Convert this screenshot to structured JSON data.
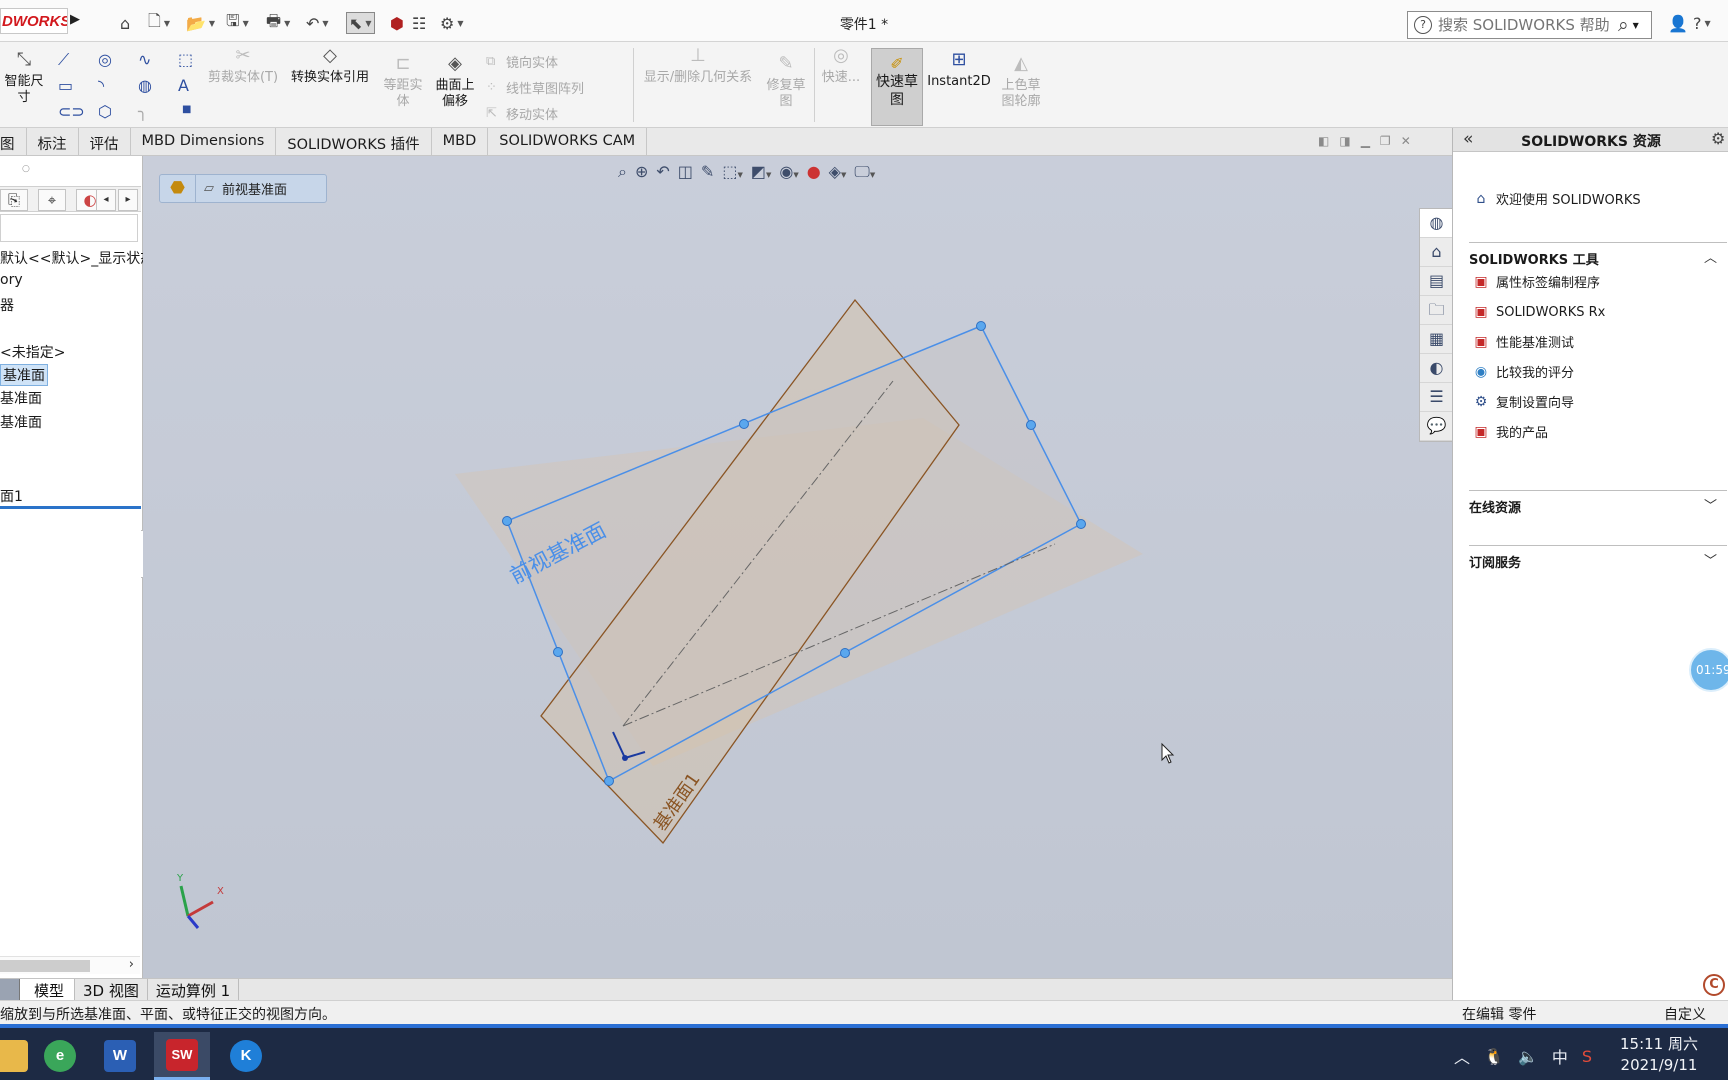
{
  "titlebar": {
    "logo_text": "DWORKS",
    "doc_title": "零件1 *",
    "search_placeholder": "搜索 SOLIDWORKS 帮助",
    "help_glyph": "?",
    "help_question": "?",
    "quick_access_icons": [
      "home-icon",
      "new-icon",
      "open-icon",
      "save-icon",
      "print-icon",
      "undo-icon",
      "select-icon",
      "rebuild-icon",
      "file-properties-icon",
      "options-icon"
    ]
  },
  "command_manager": {
    "smart_dim_label": "智能尺寸",
    "trim_label": "剪裁实体(T)",
    "convert_label": "转换实体引用",
    "offset_label_1": "等距实",
    "offset_label_2": "体",
    "surface_offset_1": "曲面上",
    "surface_offset_2": "偏移",
    "mirror_label": "镜向实体",
    "linear_pattern_label": "线性草图阵列",
    "move_label": "移动实体",
    "display_relations_label": "显示/删除几何关系",
    "repair_1": "修复草",
    "repair_2": "图",
    "quick_snap_label": "快速...",
    "quick_sketch_1": "快速草",
    "quick_sketch_2": "图",
    "instant2d_label": "Instant2D",
    "shaded_1": "上色草",
    "shaded_2": "图轮廓"
  },
  "tabs": [
    {
      "label": "图"
    },
    {
      "label": "标注"
    },
    {
      "label": "评估"
    },
    {
      "label": "MBD Dimensions"
    },
    {
      "label": "SOLIDWORKS 插件"
    },
    {
      "label": "MBD"
    },
    {
      "label": "SOLIDWORKS CAM"
    }
  ],
  "feature_tree": {
    "rows": [
      {
        "label": "默认<<默认>_显示状态"
      },
      {
        "label": "ory"
      },
      {
        "label": "器"
      },
      {
        "label": "<未指定>"
      },
      {
        "label": "基准面"
      },
      {
        "label": "基准面"
      },
      {
        "label": "基准面"
      },
      {
        "label": "面1"
      }
    ]
  },
  "viewport": {
    "breadcrumb_label": "前视基准面",
    "front_plane_label": "前视基准面",
    "plane1_label": "基准面1",
    "triad_x": "X",
    "triad_y": "Y",
    "colors": {
      "front_plane_border": "#4a8fe8",
      "plane1_border": "#8a5524",
      "background": "#c4cad6"
    }
  },
  "bottom_tabs": [
    {
      "label": "模型",
      "active": true
    },
    {
      "label": "3D 视图",
      "active": false
    },
    {
      "label": "运动算例 1",
      "active": false
    }
  ],
  "status_bar": {
    "left_text": "缩放到与所选基准面、平面、或特征正交的视图方向。",
    "mid_text": "在编辑 零件",
    "right_text": "自定义"
  },
  "task_pane": {
    "title": "SOLIDWORKS 资源",
    "welcome_label": "欢迎使用 SOLIDWORKS",
    "tools_section": "SOLIDWORKS 工具",
    "tools": [
      {
        "label": "属性标签编制程序",
        "icon": "property-tab-builder-icon"
      },
      {
        "label": "SOLIDWORKS Rx",
        "icon": "solidworks-rx-icon"
      },
      {
        "label": "性能基准测试",
        "icon": "benchmark-icon"
      },
      {
        "label": "比较我的评分",
        "icon": "compare-score-icon"
      },
      {
        "label": "复制设置向导",
        "icon": "copy-settings-icon"
      },
      {
        "label": "我的产品",
        "icon": "my-products-icon"
      }
    ],
    "online_section": "在线资源",
    "subscription_section": "订阅服务",
    "timer_text": "01:59",
    "corner_badge": "C"
  },
  "taskbar": {
    "apps": [
      {
        "name": "file-explorer",
        "glyph": "",
        "color": "#e8b84a"
      },
      {
        "name": "browser",
        "glyph": "e",
        "color": "#3aa65a"
      },
      {
        "name": "word",
        "glyph": "W",
        "color": "#2b5fb4"
      },
      {
        "name": "solidworks",
        "glyph": "SW",
        "color": "#c8252c"
      },
      {
        "name": "k-app",
        "glyph": "K",
        "color": "#1f7fd8"
      }
    ],
    "tray_ime": "中",
    "clock_time": "15:11 周六",
    "clock_date": "2021/9/11"
  }
}
